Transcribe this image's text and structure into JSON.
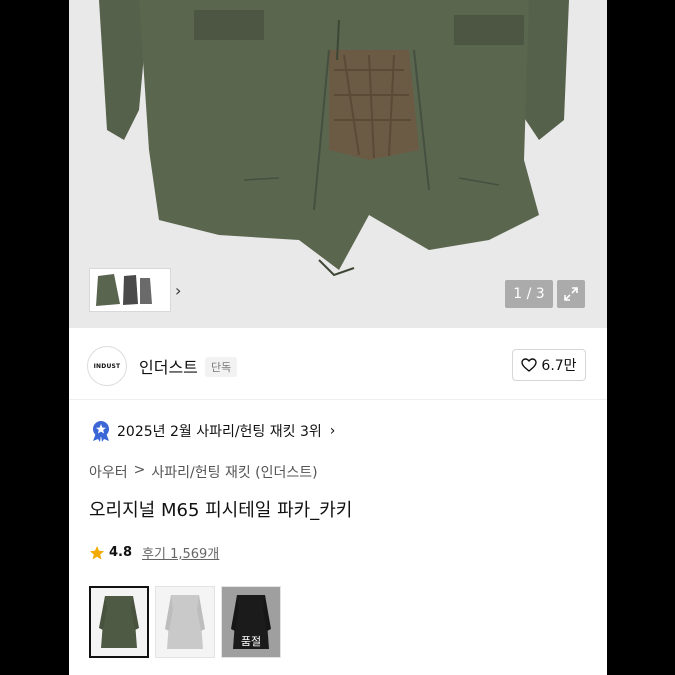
{
  "gallery": {
    "counter": "1 / 3",
    "thumbnail_icon": "coat-variants-thumbnail",
    "next_icon": "chevron-right-icon",
    "expand_icon": "expand-icon"
  },
  "brand": {
    "logo_text": "INDUST",
    "name": "인더스트",
    "tag": "단독",
    "likes": "6.7만"
  },
  "ranking": {
    "text": "2025년 2월 사파리/헌팅 재킷 3위"
  },
  "breadcrumb": {
    "level1": "아우터",
    "separator": ">",
    "level2": "사파리/헌팅 재킷 (인더스트)"
  },
  "product": {
    "title": "오리지널 M65 피시테일 파카_카키"
  },
  "rating": {
    "score": "4.8",
    "reviews": "후기 1,569개"
  },
  "color_options": [
    {
      "name": "카키",
      "color": "#4f5a44",
      "selected": true
    },
    {
      "name": "그레이",
      "color": "#c9c9c9",
      "selected": false
    },
    {
      "name": "블랙",
      "color": "#2a2a2a",
      "selected": false,
      "badge": "품절"
    }
  ],
  "colors": {
    "coat_khaki": "#5a6550",
    "lining": "#6b5a44",
    "star": "#f2a900",
    "rank_badge": "#3a66d6"
  }
}
